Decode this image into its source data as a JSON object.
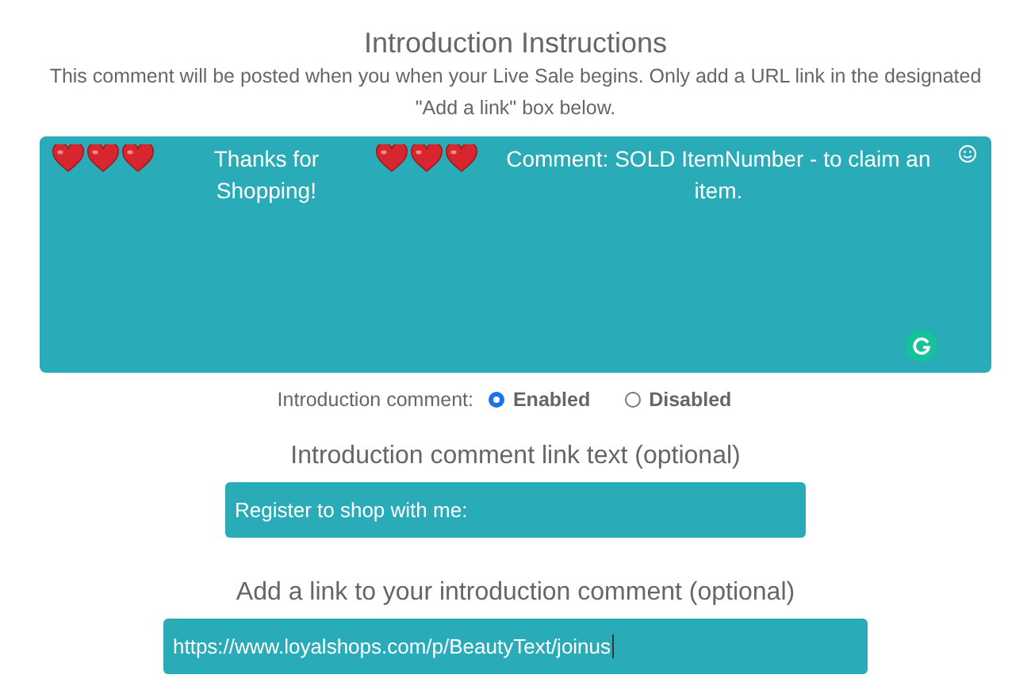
{
  "title": "Introduction Instructions",
  "description": "This comment will be posted when you when your Live Sale begins. Only add a URL link in the designated \"Add a link\" box below.",
  "comment": {
    "segments": [
      {
        "kind": "heart"
      },
      {
        "kind": "heart"
      },
      {
        "kind": "heart"
      },
      {
        "kind": "text",
        "text": "Thanks for Shopping!"
      },
      {
        "kind": "heart"
      },
      {
        "kind": "heart"
      },
      {
        "kind": "heart"
      },
      {
        "kind": "text",
        "text": "Comment: SOLD ItemNumber - to claim an item."
      }
    ]
  },
  "intro_toggle": {
    "label": "Introduction comment:",
    "options": [
      {
        "label": "Enabled",
        "selected": true
      },
      {
        "label": "Disabled",
        "selected": false
      }
    ]
  },
  "link_text": {
    "label": "Introduction comment link text (optional)",
    "value": "Register to shop with me:"
  },
  "link_url": {
    "label": "Add a link to your introduction comment (optional)",
    "value": "https://www.loyalshops.com/p/BeautyText/joinus"
  }
}
